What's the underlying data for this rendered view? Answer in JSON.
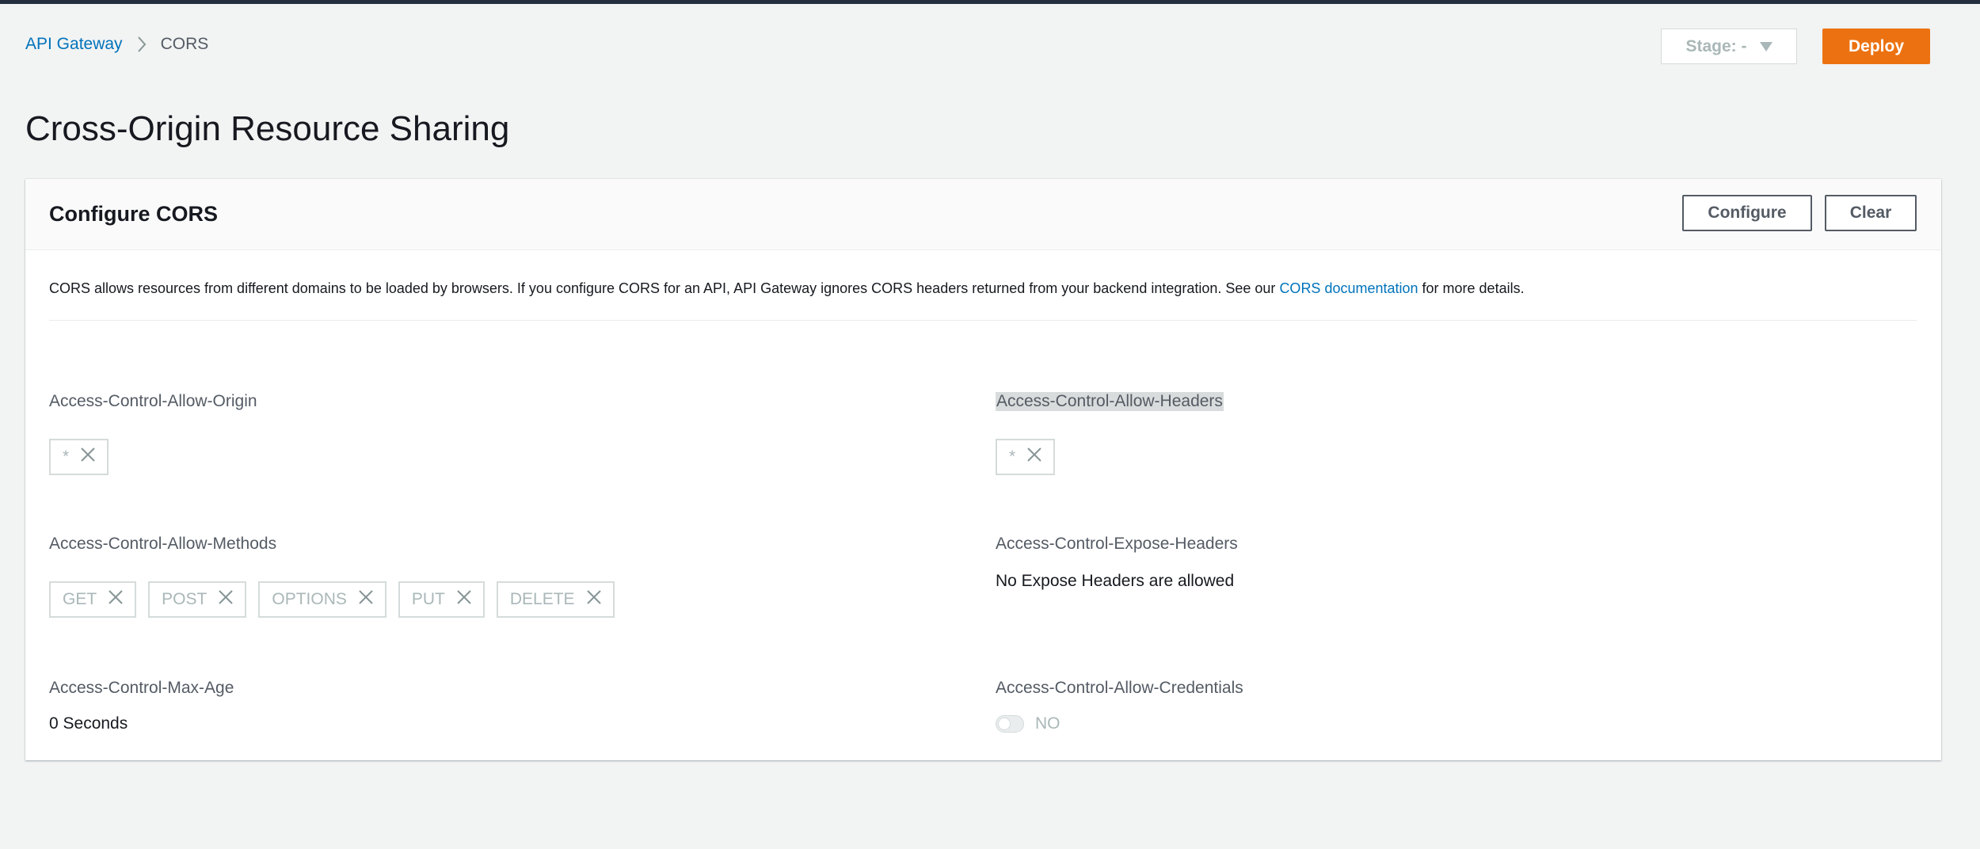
{
  "breadcrumb": {
    "root": "API Gateway",
    "current": "CORS"
  },
  "toolbar": {
    "stage_label": "Stage: -",
    "deploy_label": "Deploy"
  },
  "page": {
    "title": "Cross-Origin Resource Sharing"
  },
  "panel": {
    "title": "Configure CORS",
    "configure_label": "Configure",
    "clear_label": "Clear",
    "description_pre": "CORS allows resources from different domains to be loaded by browsers. If you configure CORS for an API, API Gateway ignores CORS headers returned from your backend integration. See our ",
    "description_link": "CORS documentation",
    "description_post": " for more details."
  },
  "fields": {
    "allow_origin": {
      "label": "Access-Control-Allow-Origin",
      "tokens": [
        "*"
      ]
    },
    "allow_headers": {
      "label": "Access-Control-Allow-Headers",
      "tokens": [
        "*"
      ]
    },
    "allow_methods": {
      "label": "Access-Control-Allow-Methods",
      "tokens": [
        "GET",
        "POST",
        "OPTIONS",
        "PUT",
        "DELETE"
      ]
    },
    "expose_headers": {
      "label": "Access-Control-Expose-Headers",
      "value": "No Expose Headers are allowed"
    },
    "max_age": {
      "label": "Access-Control-Max-Age",
      "value": "0 Seconds"
    },
    "allow_credentials": {
      "label": "Access-Control-Allow-Credentials",
      "toggle_label": "NO"
    }
  },
  "colors": {
    "accent": "#ec7211",
    "link": "#0073bb",
    "header": "#232f3e"
  },
  "icons": {
    "breadcrumb_separator": "chevron-right-icon",
    "stage_dropdown": "caret-down-icon",
    "token_remove": "close-icon"
  }
}
